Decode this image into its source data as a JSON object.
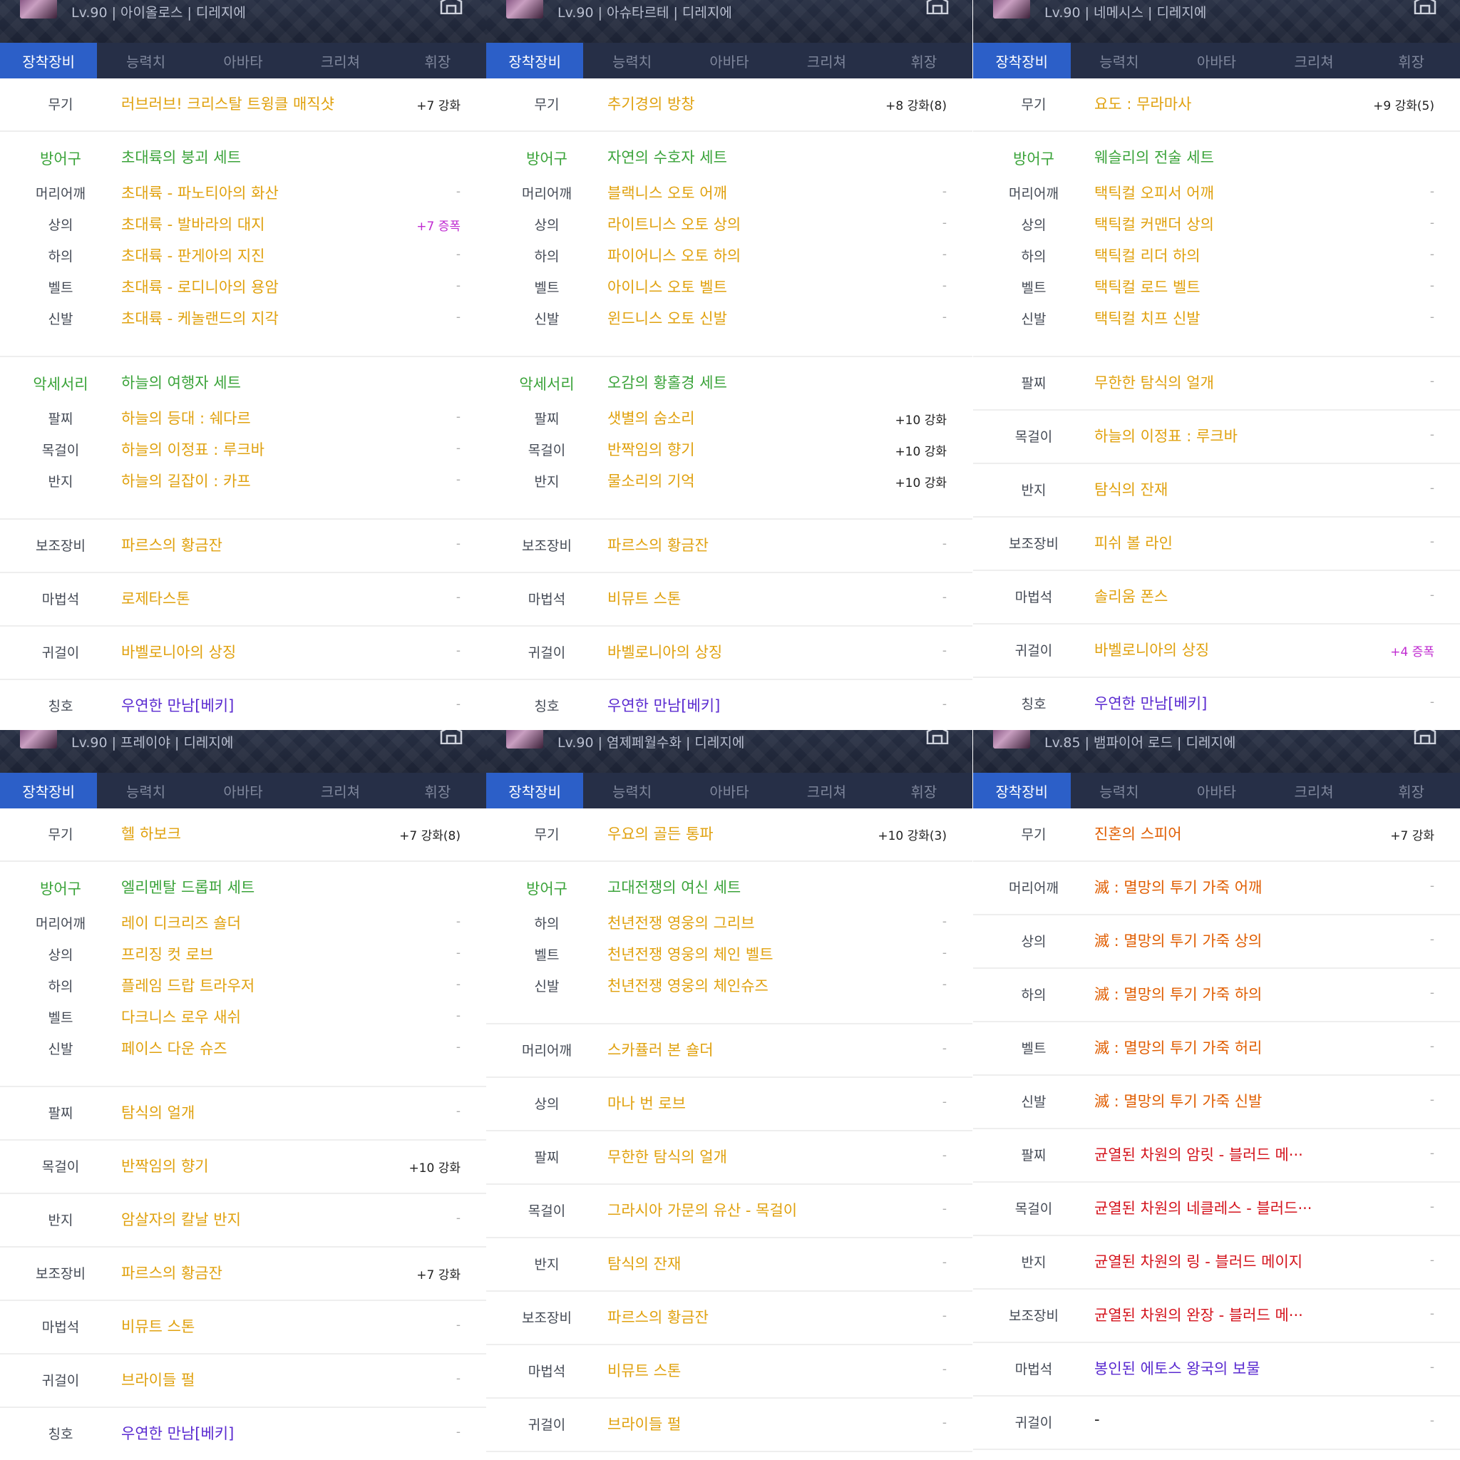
{
  "tabs": [
    "장착장비",
    "능력치",
    "아바타",
    "크리쳐",
    "휘장"
  ],
  "panels": [
    {
      "info": "Lv.90 | 아이올로스 | 디레지에",
      "rows": [
        {
          "slot": "무기",
          "item": "러브러브! 크리스탈 트윙클 매직샷",
          "enh": "+7 강화",
          "color": "#e0a10e",
          "type": "single"
        },
        {
          "slot": "방어구",
          "item": "초대륙의 붕괴 세트",
          "enh": "",
          "color": "#3aa339",
          "type": "set"
        },
        {
          "slot": "머리어깨",
          "item": "초대륙 - 파노티아의 화산",
          "enh": "-",
          "color": "#e0a10e",
          "type": "sub"
        },
        {
          "slot": "상의",
          "item": "초대륙 - 발바라의 대지",
          "enh": "+7 증폭",
          "color": "#e0a10e",
          "type": "sub",
          "amp": true
        },
        {
          "slot": "하의",
          "item": "초대륙 - 판게아의 지진",
          "enh": "-",
          "color": "#e0a10e",
          "type": "sub"
        },
        {
          "slot": "벨트",
          "item": "초대륙 - 로디니아의 용암",
          "enh": "-",
          "color": "#e0a10e",
          "type": "sub"
        },
        {
          "slot": "신발",
          "item": "초대륙 - 케놀랜드의 지각",
          "enh": "-",
          "color": "#e0a10e",
          "type": "sub",
          "last": true
        },
        {
          "slot": "악세서리",
          "item": "하늘의 여행자 세트",
          "enh": "",
          "color": "#3aa339",
          "type": "set"
        },
        {
          "slot": "팔찌",
          "item": "하늘의 등대 : 쉐다르",
          "enh": "-",
          "color": "#e0a10e",
          "type": "sub"
        },
        {
          "slot": "목걸이",
          "item": "하늘의 이정표 : 루크바",
          "enh": "-",
          "color": "#e0a10e",
          "type": "sub"
        },
        {
          "slot": "반지",
          "item": "하늘의 길잡이 : 카프",
          "enh": "-",
          "color": "#e0a10e",
          "type": "sub",
          "last": true
        },
        {
          "slot": "보조장비",
          "item": "파르스의 황금잔",
          "enh": "-",
          "color": "#e0a10e",
          "type": "single"
        },
        {
          "slot": "마법석",
          "item": "로제타스톤",
          "enh": "-",
          "color": "#e0a10e",
          "type": "single"
        },
        {
          "slot": "귀걸이",
          "item": "바벨로니아의 상징",
          "enh": "-",
          "color": "#e0a10e",
          "type": "single"
        },
        {
          "slot": "칭호",
          "item": "우연한 만남[베키]",
          "enh": "-",
          "color": "#5a2ad0",
          "type": "single"
        }
      ]
    },
    {
      "info": "Lv.90 | 아슈타르테 | 디레지에",
      "rows": [
        {
          "slot": "무기",
          "item": "추기경의 방창",
          "enh": "+8 강화(8)",
          "color": "#e0a10e",
          "type": "single"
        },
        {
          "slot": "방어구",
          "item": "자연의 수호자 세트",
          "enh": "",
          "color": "#3aa339",
          "type": "set"
        },
        {
          "slot": "머리어깨",
          "item": "블랙니스 오토 어깨",
          "enh": "-",
          "color": "#e0a10e",
          "type": "sub"
        },
        {
          "slot": "상의",
          "item": "라이트니스 오토 상의",
          "enh": "-",
          "color": "#e0a10e",
          "type": "sub"
        },
        {
          "slot": "하의",
          "item": "파이어니스 오토 하의",
          "enh": "-",
          "color": "#e0a10e",
          "type": "sub"
        },
        {
          "slot": "벨트",
          "item": "아이니스 오토 벨트",
          "enh": "-",
          "color": "#e0a10e",
          "type": "sub"
        },
        {
          "slot": "신발",
          "item": "윈드니스 오토 신발",
          "enh": "-",
          "color": "#e0a10e",
          "type": "sub",
          "last": true
        },
        {
          "slot": "악세서리",
          "item": "오감의 황홀경 세트",
          "enh": "",
          "color": "#3aa339",
          "type": "set"
        },
        {
          "slot": "팔찌",
          "item": "샛별의 숨소리",
          "enh": "+10 강화",
          "color": "#e0a10e",
          "type": "sub"
        },
        {
          "slot": "목걸이",
          "item": "반짝임의 향기",
          "enh": "+10 강화",
          "color": "#e0a10e",
          "type": "sub"
        },
        {
          "slot": "반지",
          "item": "물소리의 기억",
          "enh": "+10 강화",
          "color": "#e0a10e",
          "type": "sub",
          "last": true
        },
        {
          "slot": "보조장비",
          "item": "파르스의 황금잔",
          "enh": "-",
          "color": "#e0a10e",
          "type": "single"
        },
        {
          "slot": "마법석",
          "item": "비뮤트 스톤",
          "enh": "-",
          "color": "#e0a10e",
          "type": "single"
        },
        {
          "slot": "귀걸이",
          "item": "바벨로니아의 상징",
          "enh": "-",
          "color": "#e0a10e",
          "type": "single"
        },
        {
          "slot": "칭호",
          "item": "우연한 만남[베키]",
          "enh": "-",
          "color": "#5a2ad0",
          "type": "single"
        }
      ]
    },
    {
      "info": "Lv.90 | 네메시스 | 디레지에",
      "rows": [
        {
          "slot": "무기",
          "item": "요도 : 무라마사",
          "enh": "+9 강화(5)",
          "color": "#e0a10e",
          "type": "single"
        },
        {
          "slot": "방어구",
          "item": "웨슬리의 전술 세트",
          "enh": "",
          "color": "#3aa339",
          "type": "set"
        },
        {
          "slot": "머리어깨",
          "item": "택틱컬 오피서 어깨",
          "enh": "-",
          "color": "#e0a10e",
          "type": "sub"
        },
        {
          "slot": "상의",
          "item": "택틱컬 커맨더 상의",
          "enh": "-",
          "color": "#e0a10e",
          "type": "sub"
        },
        {
          "slot": "하의",
          "item": "택틱컬 리더 하의",
          "enh": "-",
          "color": "#e0a10e",
          "type": "sub"
        },
        {
          "slot": "벨트",
          "item": "택틱컬 로드 벨트",
          "enh": "-",
          "color": "#e0a10e",
          "type": "sub"
        },
        {
          "slot": "신발",
          "item": "택틱컬 치프 신발",
          "enh": "-",
          "color": "#e0a10e",
          "type": "sub",
          "last": true
        },
        {
          "slot": "팔찌",
          "item": "무한한 탐식의 얼개",
          "enh": "-",
          "color": "#e0a10e",
          "type": "single"
        },
        {
          "slot": "목걸이",
          "item": "하늘의 이정표 : 루크바",
          "enh": "-",
          "color": "#e0a10e",
          "type": "single"
        },
        {
          "slot": "반지",
          "item": "탐식의 잔재",
          "enh": "-",
          "color": "#e0a10e",
          "type": "single"
        },
        {
          "slot": "보조장비",
          "item": "피쉬 볼 라인",
          "enh": "-",
          "color": "#e0a10e",
          "type": "single"
        },
        {
          "slot": "마법석",
          "item": "솔리움 폰스",
          "enh": "-",
          "color": "#e0a10e",
          "type": "single"
        },
        {
          "slot": "귀걸이",
          "item": "바벨로니아의 상징",
          "enh": "+4 증폭",
          "color": "#e0a10e",
          "type": "single",
          "amp": true
        },
        {
          "slot": "칭호",
          "item": "우연한 만남[베키]",
          "enh": "-",
          "color": "#5a2ad0",
          "type": "single"
        }
      ]
    },
    {
      "info": "Lv.90 | 프레이야 | 디레지에",
      "rows": [
        {
          "slot": "무기",
          "item": "헬 하보크",
          "enh": "+7 강화(8)",
          "color": "#e0a10e",
          "type": "single"
        },
        {
          "slot": "방어구",
          "item": "엘리멘탈 드롭퍼 세트",
          "enh": "",
          "color": "#3aa339",
          "type": "set"
        },
        {
          "slot": "머리어깨",
          "item": "레이 디크리즈 숄더",
          "enh": "-",
          "color": "#e0a10e",
          "type": "sub"
        },
        {
          "slot": "상의",
          "item": "프리징 컷 로브",
          "enh": "-",
          "color": "#e0a10e",
          "type": "sub"
        },
        {
          "slot": "하의",
          "item": "플레임 드랍 트라우저",
          "enh": "-",
          "color": "#e0a10e",
          "type": "sub"
        },
        {
          "slot": "벨트",
          "item": "다크니스 로우 새쉬",
          "enh": "-",
          "color": "#e0a10e",
          "type": "sub"
        },
        {
          "slot": "신발",
          "item": "페이스 다운 슈즈",
          "enh": "-",
          "color": "#e0a10e",
          "type": "sub",
          "last": true
        },
        {
          "slot": "팔찌",
          "item": "탐식의 얼개",
          "enh": "-",
          "color": "#e0a10e",
          "type": "single"
        },
        {
          "slot": "목걸이",
          "item": "반짝임의 향기",
          "enh": "+10 강화",
          "color": "#e0a10e",
          "type": "single"
        },
        {
          "slot": "반지",
          "item": "암살자의 칼날 반지",
          "enh": "-",
          "color": "#e0a10e",
          "type": "single"
        },
        {
          "slot": "보조장비",
          "item": "파르스의 황금잔",
          "enh": "+7 강화",
          "color": "#e0a10e",
          "type": "single"
        },
        {
          "slot": "마법석",
          "item": "비뮤트 스톤",
          "enh": "-",
          "color": "#e0a10e",
          "type": "single"
        },
        {
          "slot": "귀걸이",
          "item": "브라이들 펄",
          "enh": "-",
          "color": "#e0a10e",
          "type": "single"
        },
        {
          "slot": "칭호",
          "item": "우연한 만남[베키]",
          "enh": "-",
          "color": "#5a2ad0",
          "type": "single"
        }
      ]
    },
    {
      "info": "Lv.90 | 염제페월수화 | 디레지에",
      "rows": [
        {
          "slot": "무기",
          "item": "우요의 골든 통파",
          "enh": "+10 강화(3)",
          "color": "#e0a10e",
          "type": "single"
        },
        {
          "slot": "방어구",
          "item": "고대전쟁의 여신 세트",
          "enh": "",
          "color": "#3aa339",
          "type": "set"
        },
        {
          "slot": "하의",
          "item": "천년전쟁 영웅의 그리브",
          "enh": "-",
          "color": "#e0a10e",
          "type": "sub"
        },
        {
          "slot": "벨트",
          "item": "천년전쟁 영웅의 체인 벨트",
          "enh": "-",
          "color": "#e0a10e",
          "type": "sub"
        },
        {
          "slot": "신발",
          "item": "천년전쟁 영웅의 체인슈즈",
          "enh": "-",
          "color": "#e0a10e",
          "type": "sub",
          "last": true
        },
        {
          "slot": "머리어깨",
          "item": "스카퓰러 본 숄더",
          "enh": "-",
          "color": "#e0a10e",
          "type": "single"
        },
        {
          "slot": "상의",
          "item": "마나 번 로브",
          "enh": "-",
          "color": "#e0a10e",
          "type": "single"
        },
        {
          "slot": "팔찌",
          "item": "무한한 탐식의 얼개",
          "enh": "-",
          "color": "#e0a10e",
          "type": "single"
        },
        {
          "slot": "목걸이",
          "item": "그라시아 가문의 유산 - 목걸이",
          "enh": "-",
          "color": "#e0a10e",
          "type": "single"
        },
        {
          "slot": "반지",
          "item": "탐식의 잔재",
          "enh": "-",
          "color": "#e0a10e",
          "type": "single"
        },
        {
          "slot": "보조장비",
          "item": "파르스의 황금잔",
          "enh": "-",
          "color": "#e0a10e",
          "type": "single"
        },
        {
          "slot": "마법석",
          "item": "비뮤트 스톤",
          "enh": "-",
          "color": "#e0a10e",
          "type": "single"
        },
        {
          "slot": "귀걸이",
          "item": "브라이들 펄",
          "enh": "-",
          "color": "#e0a10e",
          "type": "single"
        }
      ]
    },
    {
      "info": "Lv.85 | 뱀파이어 로드 | 디레지에",
      "rows": [
        {
          "slot": "무기",
          "item": "진혼의 스피어",
          "enh": "+7 강화",
          "color": "#e05d00",
          "type": "single"
        },
        {
          "slot": "머리어깨",
          "item": "滅 : 멸망의 투기 가죽 어깨",
          "enh": "-",
          "color": "#e05d00",
          "type": "single"
        },
        {
          "slot": "상의",
          "item": "滅 : 멸망의 투기 가죽 상의",
          "enh": "-",
          "color": "#e05d00",
          "type": "single"
        },
        {
          "slot": "하의",
          "item": "滅 : 멸망의 투기 가죽 하의",
          "enh": "-",
          "color": "#e05d00",
          "type": "single"
        },
        {
          "slot": "벨트",
          "item": "滅 : 멸망의 투기 가죽 허리",
          "enh": "-",
          "color": "#e05d00",
          "type": "single"
        },
        {
          "slot": "신발",
          "item": "滅 : 멸망의 투기 가죽 신발",
          "enh": "-",
          "color": "#e05d00",
          "type": "single"
        },
        {
          "slot": "팔찌",
          "item": "균열된 차원의 암릿 - 블러드 메···",
          "enh": "-",
          "color": "#d4131c",
          "type": "single"
        },
        {
          "slot": "목걸이",
          "item": "균열된 차원의 네클레스 - 블러드···",
          "enh": "-",
          "color": "#d4131c",
          "type": "single"
        },
        {
          "slot": "반지",
          "item": "균열된 차원의 링 - 블러드 메이지",
          "enh": "-",
          "color": "#d4131c",
          "type": "single"
        },
        {
          "slot": "보조장비",
          "item": "균열된 차원의 완장 - 블러드 메···",
          "enh": "-",
          "color": "#d4131c",
          "type": "single"
        },
        {
          "slot": "마법석",
          "item": "봉인된 에토스 왕국의 보물",
          "enh": "-",
          "color": "#5a2ad0",
          "type": "single"
        },
        {
          "slot": "귀걸이",
          "item": "-",
          "enh": "-",
          "color": "#222222",
          "type": "single"
        }
      ]
    }
  ]
}
